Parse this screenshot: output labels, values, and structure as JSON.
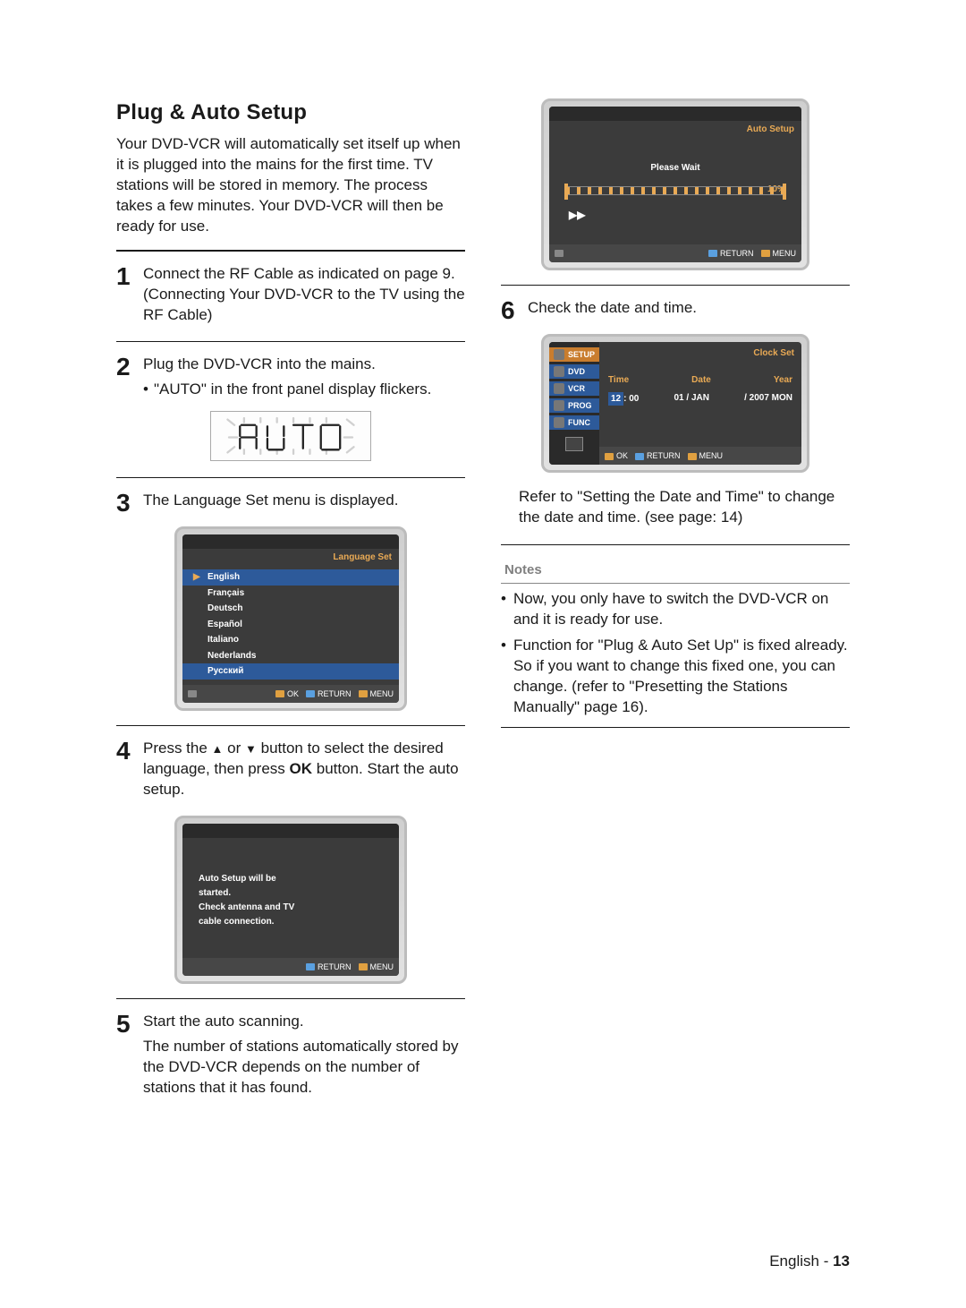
{
  "heading": "Plug & Auto Setup",
  "intro": "Your DVD-VCR will automatically set itself up when it is plugged into the mains for the first time. TV stations will be stored in memory. The process takes a few minutes. Your DVD-VCR will then be ready for use.",
  "steps": {
    "s1": {
      "num": "1",
      "text": "Connect the RF Cable as indicated on page 9. (Connecting Your DVD-VCR to the TV using the RF Cable)"
    },
    "s2": {
      "num": "2",
      "text": "Plug the DVD-VCR into the mains.",
      "bullet": "\"AUTO\" in the front panel display flickers."
    },
    "s3": {
      "num": "3",
      "text": "The Language Set menu is displayed."
    },
    "s4": {
      "num": "4",
      "pre": "Press the ",
      "mid": " or ",
      "post": " button to select the desired language, then press ",
      "bold": "OK",
      "tail": " button. Start the auto setup."
    },
    "s5": {
      "num": "5",
      "text": "Start the auto scanning.",
      "text2": "The number of stations automatically stored by the DVD-VCR depends on the number of stations that it has found."
    },
    "s6": {
      "num": "6",
      "text": "Check the date and time.",
      "refer": "Refer to \"Setting the Date and Time\" to change the date and time. (see page: 14)"
    }
  },
  "lcd_text": "AUTO",
  "langscreen": {
    "title": "Language Set",
    "items": [
      "English",
      "Français",
      "Deutsch",
      "Español",
      "Italiano",
      "Nederlands",
      "Русский"
    ],
    "foot": {
      "ok": "OK",
      "ret": "RETURN",
      "menu": "MENU"
    }
  },
  "autosetup_msg": {
    "l1": "Auto Setup will be",
    "l2": "started.",
    "l3": "Check antenna and TV",
    "l4": "cable connection.",
    "foot": {
      "ret": "RETURN",
      "menu": "MENU"
    }
  },
  "scanscreen": {
    "title": "Auto Setup",
    "wait": "Please Wait",
    "pct": "10%",
    "foot": {
      "ret": "RETURN",
      "menu": "MENU"
    }
  },
  "clockscreen": {
    "title": "Clock Set",
    "side": [
      "SETUP",
      "DVD",
      "VCR",
      "PROG",
      "FUNC"
    ],
    "cols": {
      "time": "Time",
      "date": "Date",
      "year": "Year"
    },
    "vals": {
      "time_h": "12",
      "time_m": ": 00",
      "date": "01 / JAN",
      "year": "/ 2007 MON"
    },
    "foot": {
      "ok": "OK",
      "ret": "RETURN",
      "menu": "MENU"
    }
  },
  "notes": {
    "head": "Notes",
    "items": [
      "Now, you only have to switch the DVD-VCR on and it is ready for use.",
      "Function for \"Plug & Auto Set Up\" is fixed already. So if you want to change this fixed one, you can change. (refer to \"Presetting the Stations Manually\" page 16)."
    ]
  },
  "footer": {
    "lang": "English",
    "dash": " - ",
    "page": "13"
  }
}
